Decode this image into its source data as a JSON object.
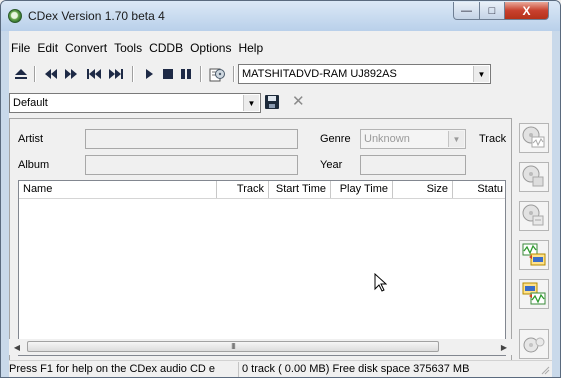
{
  "window": {
    "title": "CDex Version 1.70 beta 4"
  },
  "caption_buttons": {
    "minimize": "—",
    "maximize": "□",
    "close": "X"
  },
  "menu": [
    "File",
    "Edit",
    "Convert",
    "Tools",
    "CDDB",
    "Options",
    "Help"
  ],
  "toolbar": {
    "drive": "MATSHITADVD-RAM UJ892AS",
    "buttons": [
      "eject-icon",
      "rewind-icon",
      "fast-forward-icon",
      "previous-track-icon",
      "next-track-icon",
      "play-icon",
      "stop-icon",
      "pause-icon",
      "cd-info-icon"
    ]
  },
  "profile": {
    "value": "Default"
  },
  "fields": {
    "artist_label": "Artist",
    "album_label": "Album",
    "genre_label": "Genre",
    "genre_value": "Unknown",
    "year_label": "Year",
    "track_label": "Track"
  },
  "track_list": {
    "columns": [
      "Name",
      "Track",
      "Start Time",
      "Play Time",
      "Size",
      "Statu"
    ],
    "rows": []
  },
  "scroll": {
    "thumb_grip": "III"
  },
  "sidebar_buttons": [
    "cd-to-wav-icon",
    "cd-to-mp3-icon",
    "cd-copy-icon",
    "wav-to-mp3-icon",
    "mp3-to-wav-icon",
    "record-icon"
  ],
  "status": {
    "help": "Press F1 for help on the CDex audio CD e",
    "info": "0 track ( 0.00 MB) Free disk space 375637 MB"
  },
  "colors": {
    "titlebar": "#c9d9ea",
    "close_button": "#c8412e",
    "panel_bg": "#f0f0f0"
  }
}
